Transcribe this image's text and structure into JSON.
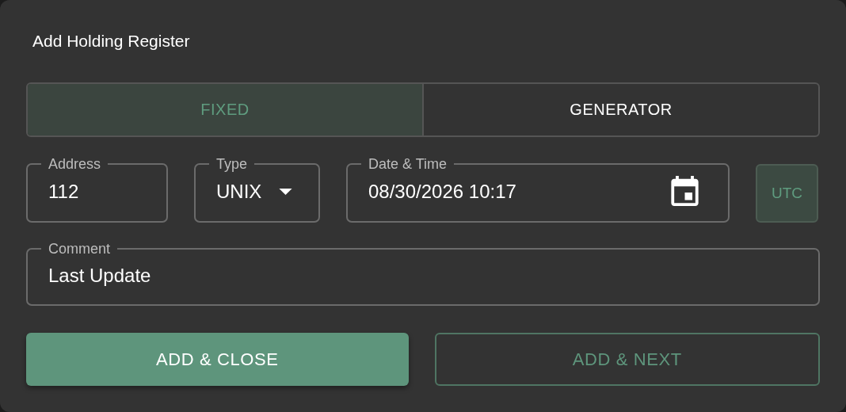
{
  "dialog": {
    "title": "Add Holding Register"
  },
  "mode_tabs": [
    {
      "label": "FIXED",
      "selected": true
    },
    {
      "label": "GENERATOR",
      "selected": false
    }
  ],
  "fields": [
    {
      "kind": "text",
      "label": "Address",
      "value": "112"
    },
    {
      "kind": "select",
      "label": "Type",
      "value": "UNIX"
    },
    {
      "kind": "datetime",
      "label": "Date & Time",
      "value": "08/30/2026 10:17"
    }
  ],
  "utc_toggle": {
    "label": "UTC",
    "selected": true
  },
  "comment": {
    "label": "Comment",
    "value": "Last Update"
  },
  "buttons": [
    {
      "label": "ADD & CLOSE",
      "kind": "filled"
    },
    {
      "label": "ADD & NEXT",
      "kind": "outlined"
    }
  ]
}
